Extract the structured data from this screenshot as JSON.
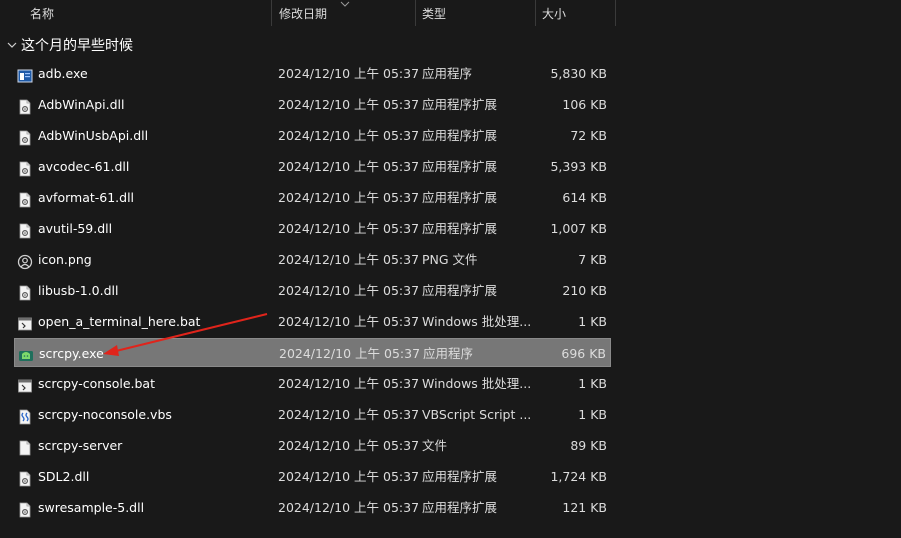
{
  "columns": {
    "name": "名称",
    "date": "修改日期",
    "type": "类型",
    "size": "大小"
  },
  "group": {
    "label": "这个月的早些时候"
  },
  "accent_colors": {
    "selection": "#777777",
    "arrow": "#e0241b",
    "background": "#191919"
  },
  "files": [
    {
      "name": "adb.exe",
      "date": "2024/12/10 上午 05:37",
      "type": "应用程序",
      "size": "5,830 KB",
      "icon": "exe-app-icon"
    },
    {
      "name": "AdbWinApi.dll",
      "date": "2024/12/10 上午 05:37",
      "type": "应用程序扩展",
      "size": "106 KB",
      "icon": "dll-file-icon"
    },
    {
      "name": "AdbWinUsbApi.dll",
      "date": "2024/12/10 上午 05:37",
      "type": "应用程序扩展",
      "size": "72 KB",
      "icon": "dll-file-icon"
    },
    {
      "name": "avcodec-61.dll",
      "date": "2024/12/10 上午 05:37",
      "type": "应用程序扩展",
      "size": "5,393 KB",
      "icon": "dll-file-icon"
    },
    {
      "name": "avformat-61.dll",
      "date": "2024/12/10 上午 05:37",
      "type": "应用程序扩展",
      "size": "614 KB",
      "icon": "dll-file-icon"
    },
    {
      "name": "avutil-59.dll",
      "date": "2024/12/10 上午 05:37",
      "type": "应用程序扩展",
      "size": "1,007 KB",
      "icon": "dll-file-icon"
    },
    {
      "name": "icon.png",
      "date": "2024/12/10 上午 05:37",
      "type": "PNG 文件",
      "size": "7 KB",
      "icon": "png-image-icon"
    },
    {
      "name": "libusb-1.0.dll",
      "date": "2024/12/10 上午 05:37",
      "type": "应用程序扩展",
      "size": "210 KB",
      "icon": "dll-file-icon"
    },
    {
      "name": "open_a_terminal_here.bat",
      "date": "2024/12/10 上午 05:37",
      "type": "Windows 批处理...",
      "size": "1 KB",
      "icon": "bat-file-icon"
    },
    {
      "name": "scrcpy.exe",
      "date": "2024/12/10 上午 05:37",
      "type": "应用程序",
      "size": "696 KB",
      "icon": "scrcpy-app-icon",
      "selected": true
    },
    {
      "name": "scrcpy-console.bat",
      "date": "2024/12/10 上午 05:37",
      "type": "Windows 批处理...",
      "size": "1 KB",
      "icon": "bat-file-icon"
    },
    {
      "name": "scrcpy-noconsole.vbs",
      "date": "2024/12/10 上午 05:37",
      "type": "VBScript Script ...",
      "size": "1 KB",
      "icon": "vbs-script-icon"
    },
    {
      "name": "scrcpy-server",
      "date": "2024/12/10 上午 05:37",
      "type": "文件",
      "size": "89 KB",
      "icon": "generic-file-icon"
    },
    {
      "name": "SDL2.dll",
      "date": "2024/12/10 上午 05:37",
      "type": "应用程序扩展",
      "size": "1,724 KB",
      "icon": "dll-file-icon"
    },
    {
      "name": "swresample-5.dll",
      "date": "2024/12/10 上午 05:37",
      "type": "应用程序扩展",
      "size": "121 KB",
      "icon": "dll-file-icon"
    }
  ]
}
